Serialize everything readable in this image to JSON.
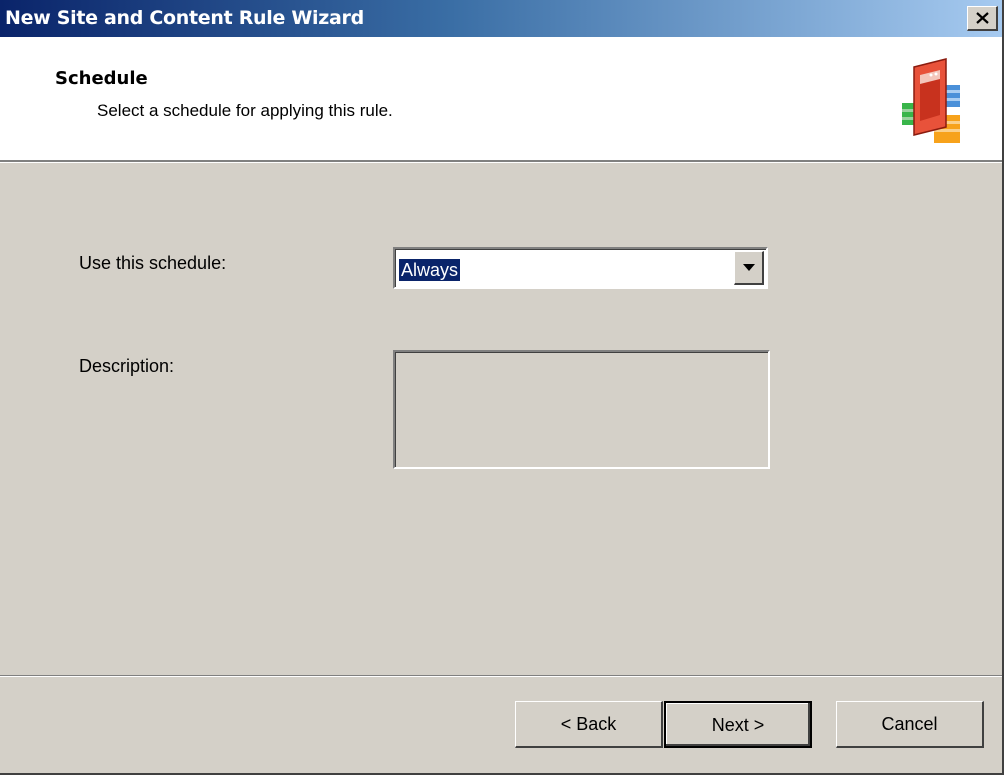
{
  "window": {
    "title": "New Site and Content Rule Wizard"
  },
  "header": {
    "title": "Schedule",
    "subtitle": "Select a schedule for applying this rule.",
    "icon": "wizard-rule-icon"
  },
  "form": {
    "schedule_label": "Use this schedule:",
    "schedule_value": "Always",
    "description_label": "Description:",
    "description_value": ""
  },
  "buttons": {
    "back": "< Back",
    "next": "Next >",
    "cancel": "Cancel"
  },
  "colors": {
    "titlebar_start": "#0a246a",
    "titlebar_end": "#a6caf0",
    "dialog_bg": "#d4d0c8",
    "selection": "#0a246a"
  }
}
